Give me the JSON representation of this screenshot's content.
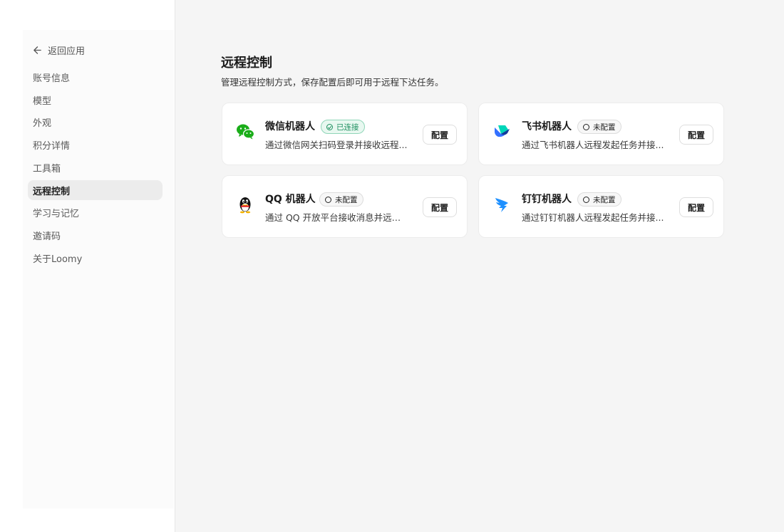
{
  "sidebar": {
    "back_label": "返回应用",
    "items": [
      {
        "label": "账号信息",
        "active": false
      },
      {
        "label": "模型",
        "active": false
      },
      {
        "label": "外观",
        "active": false
      },
      {
        "label": "积分详情",
        "active": false
      },
      {
        "label": "工具箱",
        "active": false
      },
      {
        "label": "远程控制",
        "active": true
      },
      {
        "label": "学习与记忆",
        "active": false
      },
      {
        "label": "邀请码",
        "active": false
      },
      {
        "label": "关于Loomy",
        "active": false
      }
    ]
  },
  "main": {
    "title": "远程控制",
    "subtitle": "管理远程控制方式，保存配置后即可用于远程下达任务。",
    "cards": [
      {
        "icon": "wechat-icon",
        "title": "微信机器人",
        "status": "已连接",
        "connected": true,
        "description": "通过微信网关扫码登录并接收远程...",
        "config_label": "配置"
      },
      {
        "icon": "feishu-icon",
        "title": "飞书机器人",
        "status": "未配置",
        "connected": false,
        "description": "通过飞书机器人远程发起任务并接...",
        "config_label": "配置"
      },
      {
        "icon": "qq-icon",
        "title": "QQ 机器人",
        "status": "未配置",
        "connected": false,
        "description": "通过 QQ 开放平台接收消息并远程...",
        "config_label": "配置"
      },
      {
        "icon": "dingtalk-icon",
        "title": "钉钉机器人",
        "status": "未配置",
        "connected": false,
        "description": "通过钉钉机器人远程发起任务并接...",
        "config_label": "配置"
      }
    ]
  },
  "colors": {
    "connected_green": "#1d8f5f",
    "wechat_green": "#1aad19",
    "feishu_blue": "#3370ff",
    "dingtalk_blue": "#1e90ff"
  }
}
